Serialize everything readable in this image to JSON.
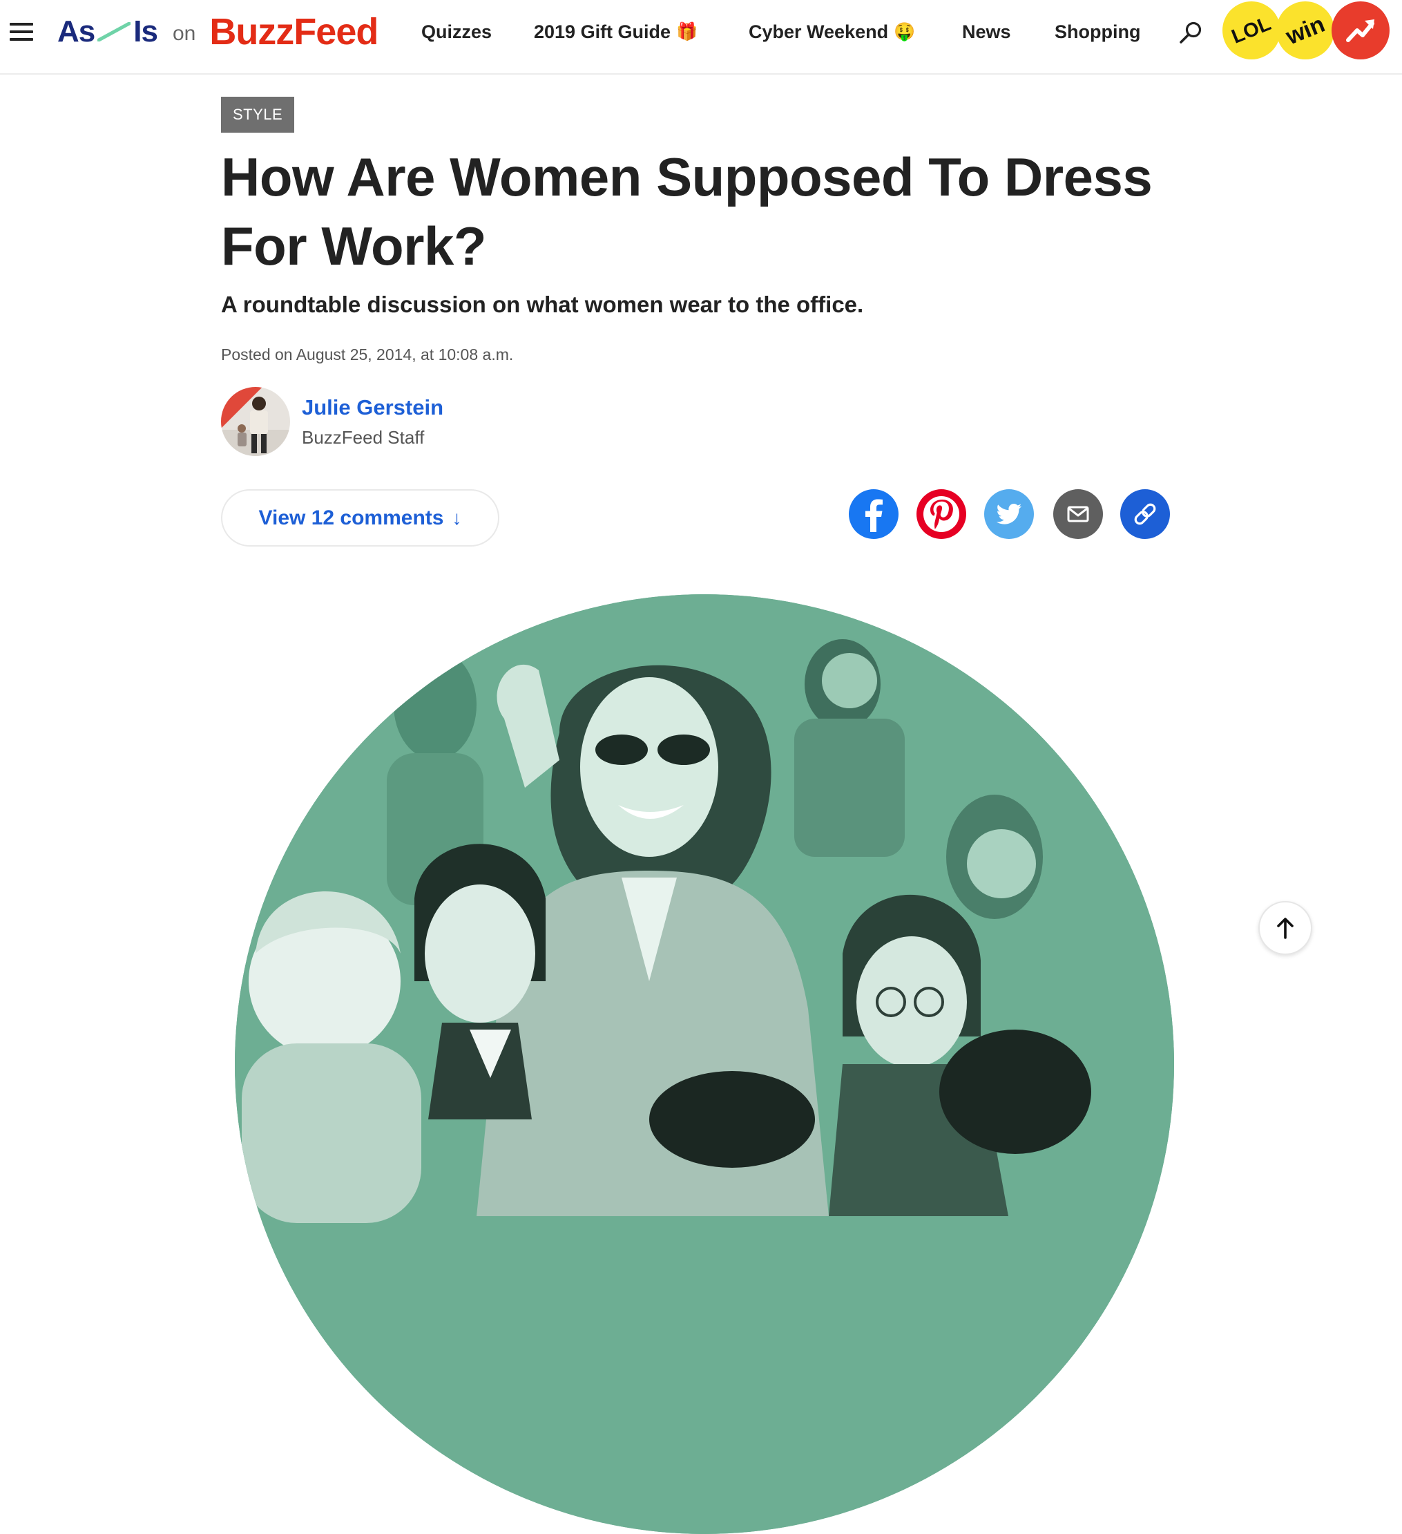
{
  "header": {
    "brand": {
      "as_part_a": "As",
      "as_part_b": "Is",
      "on": "on",
      "buzzfeed": "BuzzFeed"
    },
    "nav": [
      {
        "label": "Quizzes",
        "emoji": ""
      },
      {
        "label": "2019 Gift Guide",
        "emoji": "🎁"
      },
      {
        "label": "Cyber Weekend",
        "emoji": "🤑"
      },
      {
        "label": "News",
        "emoji": ""
      },
      {
        "label": "Shopping",
        "emoji": ""
      }
    ],
    "badges": {
      "lol": "LOL",
      "win": "win"
    }
  },
  "article": {
    "tag": "STYLE",
    "title": "How Are Women Supposed To Dress For Work?",
    "dek": "A roundtable discussion on what women wear to the office.",
    "posted": "Posted on August 25, 2014, at 10:08 a.m.",
    "author": {
      "name": "Julie Gerstein",
      "role": "BuzzFeed Staff"
    },
    "comments_label": "View 12 comments",
    "comments_arrow": "↓"
  },
  "share_buttons": [
    {
      "name": "facebook",
      "icon": "facebook-icon",
      "color": "#1877f2"
    },
    {
      "name": "pinterest",
      "icon": "pinterest-icon",
      "color": "#e60023"
    },
    {
      "name": "twitter",
      "icon": "twitter-icon",
      "color": "#55acee"
    },
    {
      "name": "email",
      "icon": "email-icon",
      "color": "#5f5f5f"
    },
    {
      "name": "copy-link",
      "icon": "link-icon",
      "color": "#1d5fd6"
    }
  ],
  "colors": {
    "brand_red": "#e32c16",
    "link_blue": "#1d5fd6",
    "hero_green": "#6dae93",
    "badge_yellow": "#fbe22c",
    "trend_red": "#e83c2c"
  }
}
